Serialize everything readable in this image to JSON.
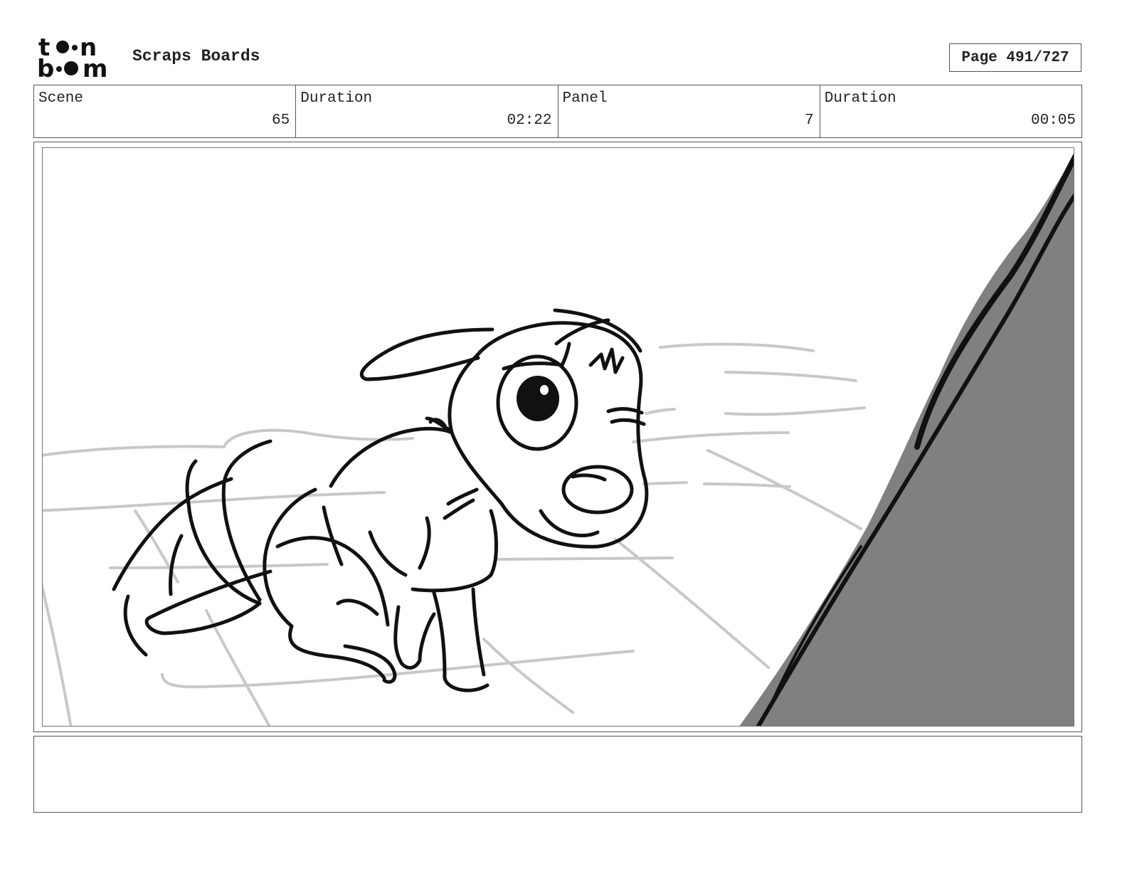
{
  "header": {
    "logo_text": "toon boom",
    "title": "Scraps Boards",
    "page_label": "Page 491/727"
  },
  "info": {
    "scene_label": "Scene",
    "scene_value": "65",
    "scene_duration_label": "Duration",
    "scene_duration_value": "02:22",
    "panel_label": "Panel",
    "panel_value": "7",
    "panel_duration_label": "Duration",
    "panel_duration_value": "00:05"
  },
  "notes": {
    "text": ""
  }
}
